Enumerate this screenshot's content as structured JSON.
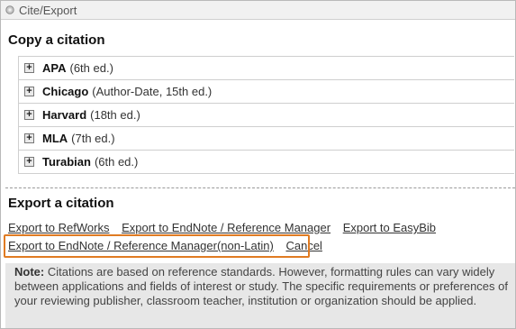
{
  "window": {
    "title": "Cite/Export",
    "icon": "gear-icon"
  },
  "copy_section": {
    "heading": "Copy a citation",
    "styles": [
      {
        "name": "APA",
        "detail": "(6th ed.)"
      },
      {
        "name": "Chicago",
        "detail": "(Author-Date, 15th ed.)"
      },
      {
        "name": "Harvard",
        "detail": "(18th ed.)"
      },
      {
        "name": "MLA",
        "detail": "(7th ed.)"
      },
      {
        "name": "Turabian",
        "detail": "(6th ed.)"
      }
    ]
  },
  "export_section": {
    "heading": "Export a citation",
    "links": {
      "refworks": "Export to RefWorks",
      "endnote": "Export to EndNote / Reference Manager",
      "easybib": "Export to EasyBib",
      "endnote_nonlatin": "Export to EndNote / Reference Manager(non-Latin)",
      "cancel": "Cancel"
    },
    "highlight_color": "#e07b22"
  },
  "note": {
    "label": "Note:",
    "text": "Citations are based on reference standards. However, formatting rules can vary widely between applications and fields of interest or study. The specific requirements or preferences of your reviewing publisher, classroom teacher, institution or organization should be applied."
  }
}
